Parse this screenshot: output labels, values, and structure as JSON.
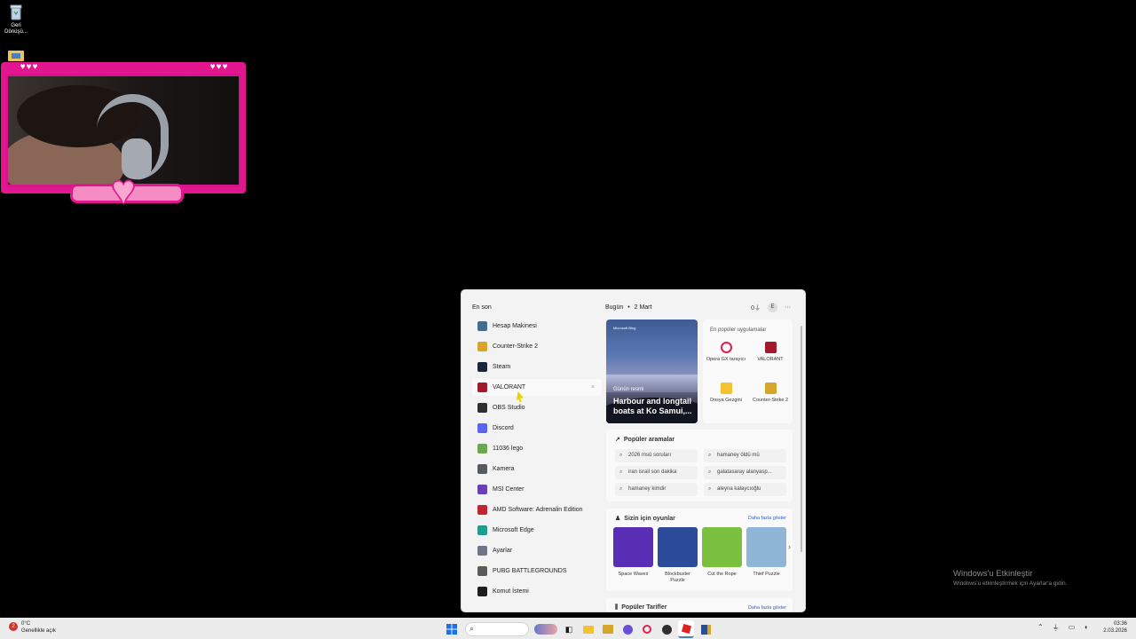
{
  "desktop": {
    "icons": [
      {
        "label": "Geri Dönüşü..."
      },
      {
        "label": ""
      }
    ]
  },
  "webcam": {
    "left_hearts": "♥♥♥",
    "right_hearts": "♥♥♥",
    "center_heart": "♥"
  },
  "start_menu": {
    "recent_title": "En son",
    "recent_apps": [
      {
        "label": "Hesap Makinesi",
        "icon": "calculator-icon",
        "color": "#4a6b8f"
      },
      {
        "label": "Counter-Strike 2",
        "icon": "cs2-icon",
        "color": "#d6a52a"
      },
      {
        "label": "Steam",
        "icon": "steam-icon",
        "color": "#1b2838"
      },
      {
        "label": "VALORANT",
        "icon": "valorant-icon",
        "color": "#a3182a"
      },
      {
        "label": "OBS Studio",
        "icon": "obs-icon",
        "color": "#302e31"
      },
      {
        "label": "Discord",
        "icon": "discord-icon",
        "color": "#5865f2"
      },
      {
        "label": "11036 lego",
        "icon": "search-icon",
        "color": "#6aa84f"
      },
      {
        "label": "Kamera",
        "icon": "camera-icon",
        "color": "#555b66"
      },
      {
        "label": "MSI Center",
        "icon": "msi-icon",
        "color": "#6a3fb5"
      },
      {
        "label": "AMD Software: Adrenalin Edition",
        "icon": "amd-icon",
        "color": "#c0262d"
      },
      {
        "label": "Microsoft Edge",
        "icon": "edge-icon",
        "color": "#1f9c8a"
      },
      {
        "label": "Ayarlar",
        "icon": "gear-icon",
        "color": "#6d7685"
      },
      {
        "label": "PUBG BATTLEGROUNDS",
        "icon": "pubg-icon",
        "color": "#5b5b5b"
      },
      {
        "label": "Komut İstemi",
        "icon": "terminal-icon",
        "color": "#1e1e1e"
      }
    ],
    "close_glyph": "×",
    "today_label": "Bugün",
    "today_sep": "•",
    "today_date": "2 Mart",
    "header_count": "0",
    "avatar_letter": "E",
    "more_glyph": "···",
    "daily_photo": {
      "brand": "Microsoft Bing",
      "caption": "Günün resmi",
      "title": "Harbour and longtail boats at Ko Samui,..."
    },
    "popular_apps": {
      "title": "En popüler uygulamalar",
      "items": [
        {
          "label": "Opera GX tarayıcı",
          "icon": "opera-gx-icon",
          "color": "#e0204f"
        },
        {
          "label": "VALORANT",
          "icon": "valorant-icon",
          "color": "#a3182a"
        },
        {
          "label": "Dosya Gezgini",
          "icon": "folder-icon",
          "color": "#f2c230"
        },
        {
          "label": "Counter-Strike 2",
          "icon": "cs2-icon",
          "color": "#d6a52a"
        }
      ]
    },
    "popular_searches": {
      "title": "Popüler aramalar",
      "items": [
        "2026 msü soruları",
        "hamaney öldü mü",
        "iran israil son dakika",
        "galatasaray alanyasp...",
        "hamaney kimdir",
        "aleyna kalaycıoğlu"
      ]
    },
    "games": {
      "title": "Sizin için oyunlar",
      "more": "Daha fazla göster",
      "items": [
        {
          "label": "Space Waves",
          "color": "#5a2fb5"
        },
        {
          "label": "Blockbuster Puzzle",
          "color": "#2c4c9b"
        },
        {
          "label": "Cut the Rope",
          "color": "#7bbf3f"
        },
        {
          "label": "Thief Puzzle",
          "color": "#8fb6d6"
        }
      ],
      "next_glyph": "›"
    },
    "recipes": {
      "title": "Popüler Tarifler",
      "more": "Daha fazla göster"
    }
  },
  "taskbar": {
    "weather_temp": "0°C",
    "weather_desc": "Genellikle açık",
    "weather_badge": "2",
    "time": "03:36",
    "date": "2.03.2026"
  },
  "activation": {
    "title": "Windows'u Etkinleştir",
    "subtitle": "Windows'u etkinleştirmek için Ayarlar'a gidin."
  }
}
